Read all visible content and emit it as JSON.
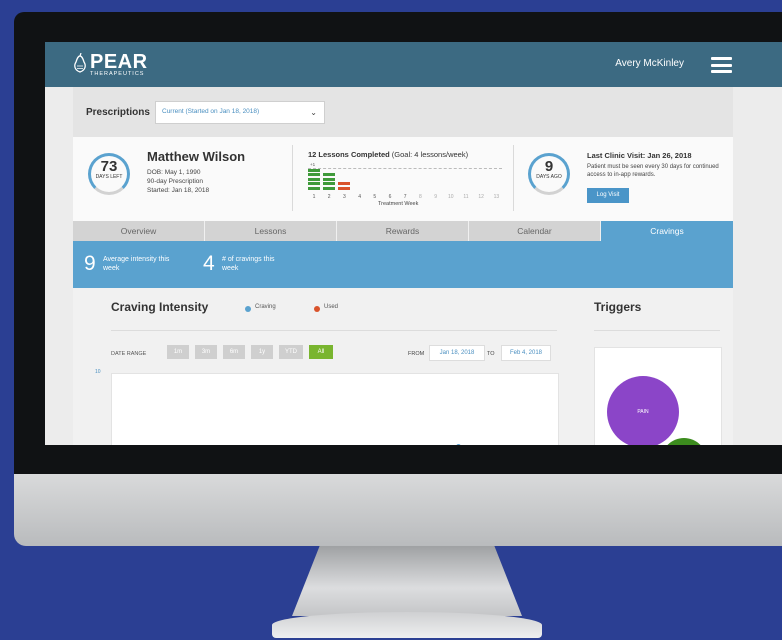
{
  "header": {
    "logo_text": "PEAR",
    "logo_subtext": "THERAPEUTICS",
    "user_name": "Avery McKinley"
  },
  "prescriptions": {
    "label": "Prescriptions",
    "selected": "Current (Started on Jan 18, 2018)"
  },
  "patient": {
    "days_left_num": "73",
    "days_left_label": "DAYS LEFT",
    "name": "Matthew Wilson",
    "dob": "DOB: May 1, 1990",
    "program": "90-day Prescription",
    "started": "Started: Jan 18, 2018"
  },
  "lessons": {
    "title_bold": "12 Lessons Completed",
    "title_goal": " (Goal: 4 lessons/week)",
    "goal_marker": "+1",
    "weeks": [
      "1",
      "2",
      "3",
      "4",
      "5",
      "6",
      "7",
      "8",
      "9",
      "10",
      "11",
      "12",
      "13"
    ],
    "completed_per_week": [
      5,
      4,
      2,
      0,
      0,
      0,
      0,
      0,
      0,
      0,
      0,
      0,
      0
    ],
    "axis_label": "Treatment Week",
    "colors": {
      "done": "#3f9a3a",
      "partial": "#d9532b"
    }
  },
  "clinic": {
    "days_ago_num": "9",
    "days_ago_label": "DAYS AGO",
    "title": "Last Clinic Visit: Jan 26, 2018",
    "note": "Patient must be seen every 30 days for continued access to in-app rewards.",
    "button": "Log Visit"
  },
  "tabs": [
    {
      "label": "Overview",
      "active": false
    },
    {
      "label": "Lessons",
      "active": false
    },
    {
      "label": "Rewards",
      "active": false
    },
    {
      "label": "Calendar",
      "active": false
    },
    {
      "label": "Cravings",
      "active": true
    }
  ],
  "stats": [
    {
      "value": "9",
      "label": "Average intensity this week"
    },
    {
      "value": "4",
      "label": "# of cravings this week"
    }
  ],
  "craving": {
    "title": "Craving Intensity",
    "legend": [
      {
        "label": "Craving",
        "color": "#5aa2cf"
      },
      {
        "label": "Used",
        "color": "#d9532b"
      }
    ],
    "date_range_label": "DATE RANGE",
    "ranges": [
      {
        "label": "1m",
        "active": false
      },
      {
        "label": "3m",
        "active": false
      },
      {
        "label": "6m",
        "active": false
      },
      {
        "label": "1y",
        "active": false
      },
      {
        "label": "YTD",
        "active": false
      },
      {
        "label": "All",
        "active": true
      }
    ],
    "from_label": "FROM",
    "from_date": "Jan 18, 2018",
    "to_label": "TO",
    "to_date": "Feb 4, 2018",
    "y_max_label": "10"
  },
  "triggers": {
    "title": "Triggers",
    "bubbles": [
      {
        "label": "PAIN",
        "color": "#8b45c8"
      },
      {
        "label": "",
        "color": "#3c8c1e"
      }
    ]
  }
}
